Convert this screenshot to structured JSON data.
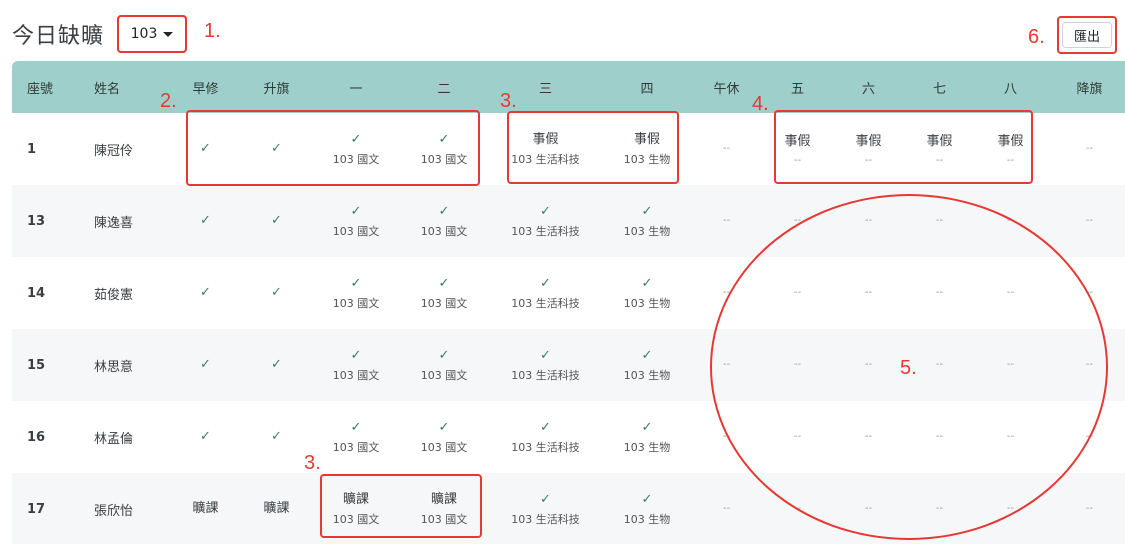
{
  "header": {
    "title": "今日缺曠",
    "class_select": "103",
    "export_label": "匯出"
  },
  "columns": [
    "座號",
    "姓名",
    "早修",
    "升旗",
    "一",
    "二",
    "三",
    "四",
    "午休",
    "五",
    "六",
    "七",
    "八",
    "降旗"
  ],
  "students": [
    {
      "seat": "1",
      "name": "陳冠伶",
      "cells": [
        {
          "status": "✓"
        },
        {
          "status": "✓"
        },
        {
          "status": "✓",
          "subject": "103 國文"
        },
        {
          "status": "✓",
          "subject": "103 國文"
        },
        {
          "status": "事假",
          "subject": "103 生活科技"
        },
        {
          "status": "事假",
          "subject": "103 生物"
        },
        {
          "status": "--"
        },
        {
          "status": "事假",
          "subject": "--"
        },
        {
          "status": "事假",
          "subject": "--"
        },
        {
          "status": "事假",
          "subject": "--"
        },
        {
          "status": "事假",
          "subject": "--"
        },
        {
          "status": "--"
        }
      ]
    },
    {
      "seat": "13",
      "name": "陳逸喜",
      "cells": [
        {
          "status": "✓"
        },
        {
          "status": "✓"
        },
        {
          "status": "✓",
          "subject": "103 國文"
        },
        {
          "status": "✓",
          "subject": "103 國文"
        },
        {
          "status": "✓",
          "subject": "103 生活科技"
        },
        {
          "status": "✓",
          "subject": "103 生物"
        },
        {
          "status": "--"
        },
        {
          "status": "--"
        },
        {
          "status": "--"
        },
        {
          "status": "--"
        },
        {
          "status": "--"
        },
        {
          "status": "--"
        }
      ]
    },
    {
      "seat": "14",
      "name": "茹俊憲",
      "cells": [
        {
          "status": "✓"
        },
        {
          "status": "✓"
        },
        {
          "status": "✓",
          "subject": "103 國文"
        },
        {
          "status": "✓",
          "subject": "103 國文"
        },
        {
          "status": "✓",
          "subject": "103 生活科技"
        },
        {
          "status": "✓",
          "subject": "103 生物"
        },
        {
          "status": "--"
        },
        {
          "status": "--"
        },
        {
          "status": "--"
        },
        {
          "status": "--"
        },
        {
          "status": "--"
        },
        {
          "status": "--"
        }
      ]
    },
    {
      "seat": "15",
      "name": "林思意",
      "cells": [
        {
          "status": "✓"
        },
        {
          "status": "✓"
        },
        {
          "status": "✓",
          "subject": "103 國文"
        },
        {
          "status": "✓",
          "subject": "103 國文"
        },
        {
          "status": "✓",
          "subject": "103 生活科技"
        },
        {
          "status": "✓",
          "subject": "103 生物"
        },
        {
          "status": "--"
        },
        {
          "status": "--"
        },
        {
          "status": "--"
        },
        {
          "status": "--"
        },
        {
          "status": "--"
        },
        {
          "status": "--"
        }
      ]
    },
    {
      "seat": "16",
      "name": "林孟倫",
      "cells": [
        {
          "status": "✓"
        },
        {
          "status": "✓"
        },
        {
          "status": "✓",
          "subject": "103 國文"
        },
        {
          "status": "✓",
          "subject": "103 國文"
        },
        {
          "status": "✓",
          "subject": "103 生活科技"
        },
        {
          "status": "✓",
          "subject": "103 生物"
        },
        {
          "status": "--"
        },
        {
          "status": "--"
        },
        {
          "status": "--"
        },
        {
          "status": "--"
        },
        {
          "status": "--"
        },
        {
          "status": "--"
        }
      ]
    },
    {
      "seat": "17",
      "name": "張欣怡",
      "cells": [
        {
          "status": "曠課"
        },
        {
          "status": "曠課"
        },
        {
          "status": "曠課",
          "subject": "103 國文"
        },
        {
          "status": "曠課",
          "subject": "103 國文"
        },
        {
          "status": "✓",
          "subject": "103 生活科技"
        },
        {
          "status": "✓",
          "subject": "103 生物"
        },
        {
          "status": "--"
        },
        {
          "status": "--"
        },
        {
          "status": "--"
        },
        {
          "status": "--"
        },
        {
          "status": "--"
        },
        {
          "status": "--"
        }
      ]
    }
  ],
  "annotations": [
    "1.",
    "2.",
    "3.",
    "4.",
    "5.",
    "6.",
    "3."
  ],
  "colors": {
    "header_bg": "#9fcfca",
    "check": "#3d7a63",
    "annotation": "#e53935"
  }
}
